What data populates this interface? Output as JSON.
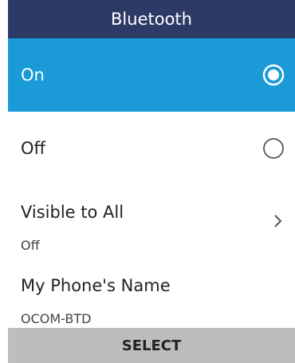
{
  "header": {
    "title": "Bluetooth"
  },
  "items": [
    {
      "label": "On",
      "control": "radio",
      "selected": true,
      "highlighted": true
    },
    {
      "label": "Off",
      "control": "radio",
      "selected": false,
      "highlighted": false
    },
    {
      "label": "Visible to All",
      "value": "Off",
      "control": "chevron-right-icon"
    },
    {
      "label": "My Phone's Name",
      "value": "OCOM-BTD"
    }
  ],
  "softkey": {
    "center_label": "SELECT"
  },
  "colors": {
    "header_bg": "#2d3a66",
    "highlight_bg": "#1a9bd7",
    "softkey_bg": "#bdbdbd"
  }
}
